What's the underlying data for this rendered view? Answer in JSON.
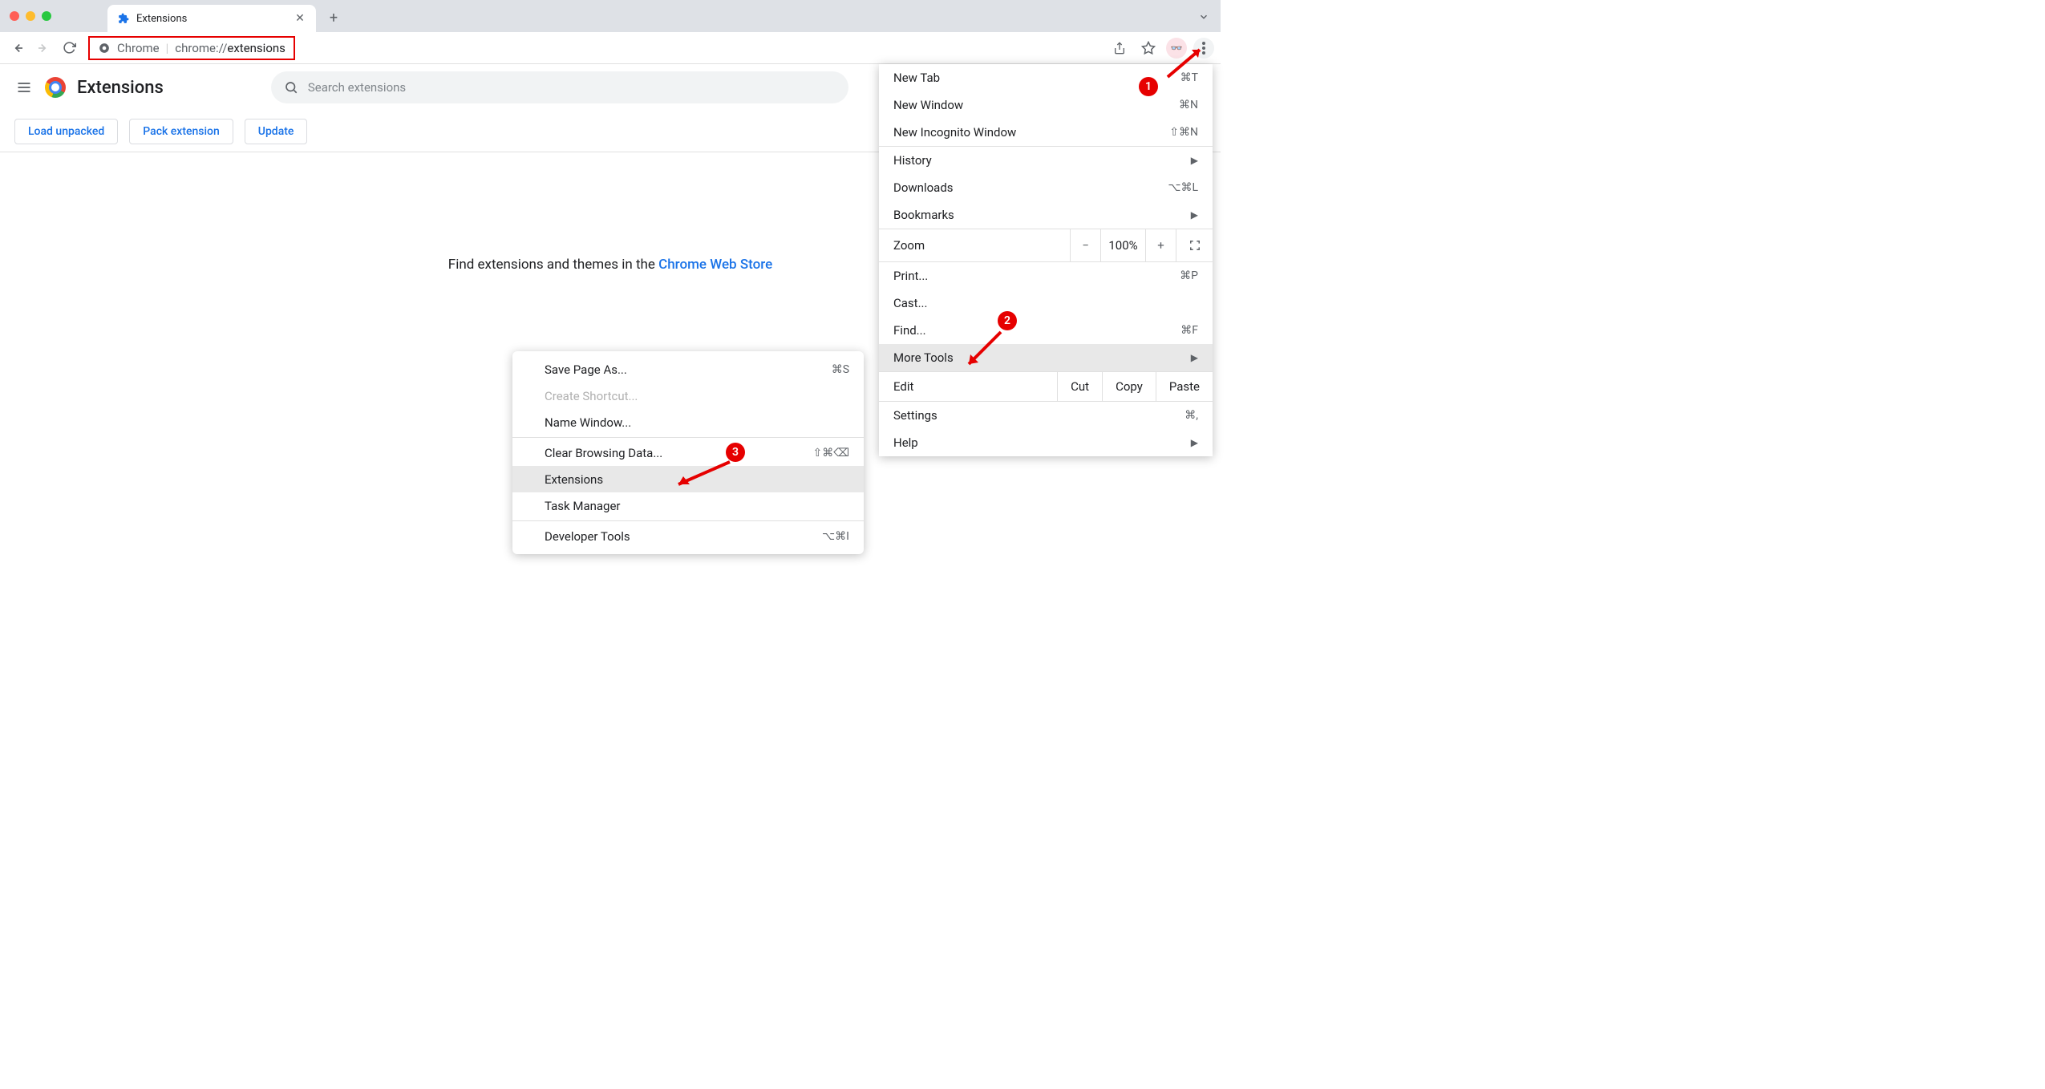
{
  "window": {
    "tab_title": "Extensions"
  },
  "address": {
    "prefix": "Chrome",
    "url_dim": "chrome://",
    "url_dark": "extensions"
  },
  "page": {
    "title": "Extensions",
    "search_placeholder": "Search extensions",
    "actions": {
      "load_unpacked": "Load unpacked",
      "pack_extension": "Pack extension",
      "update": "Update"
    },
    "body_text": "Find extensions and themes in the ",
    "body_link": "Chrome Web Store"
  },
  "menu": {
    "new_tab": "New Tab",
    "new_tab_sc": "⌘T",
    "new_window": "New Window",
    "new_window_sc": "⌘N",
    "new_incognito": "New Incognito Window",
    "new_incognito_sc": "⇧⌘N",
    "history": "History",
    "downloads": "Downloads",
    "downloads_sc": "⌥⌘L",
    "bookmarks": "Bookmarks",
    "zoom": "Zoom",
    "zoom_value": "100%",
    "print": "Print...",
    "print_sc": "⌘P",
    "cast": "Cast...",
    "find": "Find...",
    "find_sc": "⌘F",
    "more_tools": "More Tools",
    "edit": "Edit",
    "cut": "Cut",
    "copy": "Copy",
    "paste": "Paste",
    "settings": "Settings",
    "settings_sc": "⌘,",
    "help": "Help"
  },
  "submenu": {
    "save_page": "Save Page As...",
    "save_page_sc": "⌘S",
    "create_shortcut": "Create Shortcut...",
    "name_window": "Name Window...",
    "clear_browsing": "Clear Browsing Data...",
    "clear_browsing_sc": "⇧⌘⌫",
    "extensions": "Extensions",
    "task_manager": "Task Manager",
    "developer_tools": "Developer Tools",
    "developer_tools_sc": "⌥⌘I"
  },
  "annotations": {
    "step1": "1",
    "step2": "2",
    "step3": "3"
  }
}
